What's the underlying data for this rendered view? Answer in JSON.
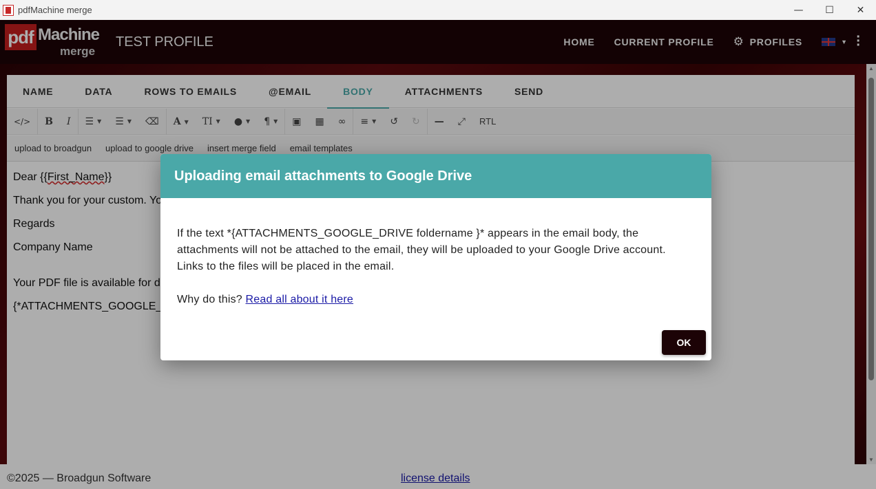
{
  "window": {
    "title": "pdfMachine merge",
    "minimize_icon": "minimize-icon",
    "maximize_icon": "maximize-icon",
    "close_icon": "close-icon"
  },
  "logo": {
    "pdf": "pdf",
    "machine": "Machine",
    "merge": "merge"
  },
  "header": {
    "profile_title": "TEST PROFILE",
    "nav": [
      "HOME",
      "CURRENT PROFILE",
      "PROFILES"
    ]
  },
  "tabs": [
    {
      "label": "NAME"
    },
    {
      "label": "DATA"
    },
    {
      "label": "ROWS TO EMAILS"
    },
    {
      "label": "@EMAIL"
    },
    {
      "label": "BODY"
    },
    {
      "label": "ATTACHMENTS"
    },
    {
      "label": "SEND"
    }
  ],
  "active_tab": "BODY",
  "toolbar": {
    "rtl_label": "RTL"
  },
  "shortcuts": [
    "upload to broadgun",
    "upload to google drive",
    "insert merge field",
    "email templates"
  ],
  "email_body": {
    "line1_prefix": "Dear {{",
    "line1_field": "First_Name",
    "line1_suffix": "}}",
    "line2": "Thank you for your custom. Yo",
    "line3": "Regards",
    "line4": "Company Name",
    "line5": "Your PDF file is available for d",
    "line6": "{*ATTACHMENTS_GOOGLE_"
  },
  "dialog": {
    "title": "Uploading email attachments to Google Drive",
    "paragraph": "If the text *{ATTACHMENTS_GOOGLE_DRIVE foldername }* appears in the email body, the attachments will not be attached to the email, they will be uploaded to your Google Drive account. Links to the files will be placed in the email.",
    "why_prefix": "Why do this? ",
    "link_text": "Read all about it here",
    "ok_label": "OK"
  },
  "footer": {
    "copyright": "©2025 — Broadgun Software",
    "license_link": "license details"
  },
  "colors": {
    "teal_accent": "#4aa8a8",
    "dark_header": "#1c0306",
    "brand_red": "#c41e1e",
    "link_blue": "#1a1aa6"
  }
}
